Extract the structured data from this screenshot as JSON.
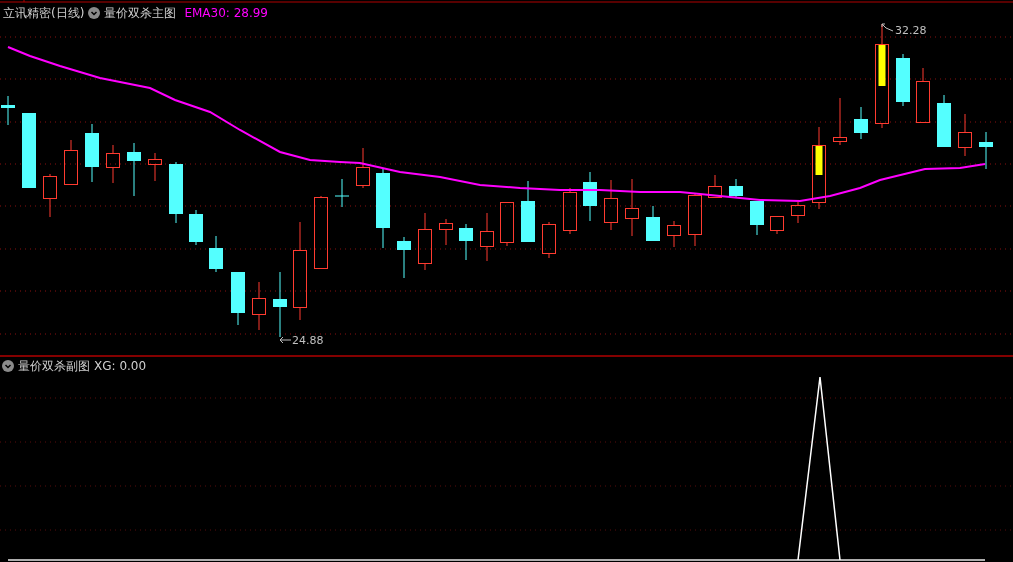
{
  "main_chart": {
    "title": "立讯精密(日线)",
    "indicator": "量价双杀主图",
    "ema_label": "EMA30: 28.99",
    "high_label": "32.28",
    "low_label": "24.88"
  },
  "sub_chart": {
    "indicator": "量价双杀副图",
    "xg_label": "XG: 0.00"
  }
}
